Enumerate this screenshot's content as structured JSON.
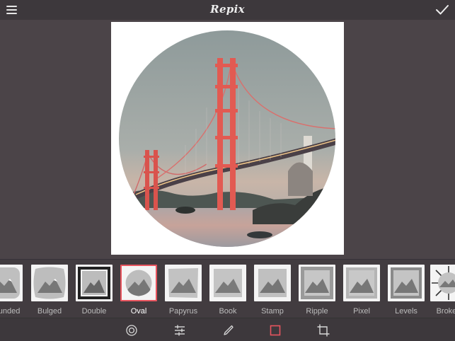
{
  "app": {
    "title": "Repix"
  },
  "header": {
    "menu_icon": "hamburger-menu-icon",
    "confirm_icon": "checkmark-icon"
  },
  "photo": {
    "subject": "golden-gate-bridge",
    "frame_shape": "oval"
  },
  "frames": {
    "selected": "Oval",
    "items": [
      {
        "label": "Rounded",
        "style": "rounded"
      },
      {
        "label": "Bulged",
        "style": "bulged"
      },
      {
        "label": "Double",
        "style": "double"
      },
      {
        "label": "Oval",
        "style": "oval"
      },
      {
        "label": "Papyrus",
        "style": "papyrus"
      },
      {
        "label": "Book",
        "style": "book"
      },
      {
        "label": "Stamp",
        "style": "stamp"
      },
      {
        "label": "Ripple",
        "style": "ripple"
      },
      {
        "label": "Pixel",
        "style": "pixel"
      },
      {
        "label": "Levels",
        "style": "levels"
      },
      {
        "label": "Broken",
        "style": "broken"
      }
    ]
  },
  "toolbar": {
    "tools": [
      {
        "name": "filters",
        "icon": "aperture-icon",
        "active": false
      },
      {
        "name": "adjust",
        "icon": "sliders-icon",
        "active": false
      },
      {
        "name": "brushes",
        "icon": "brush-icon",
        "active": false
      },
      {
        "name": "frames",
        "icon": "frame-icon",
        "active": true
      },
      {
        "name": "crop",
        "icon": "crop-icon",
        "active": false
      }
    ],
    "active_color": "#e8555f"
  },
  "colors": {
    "accent": "#e8555f",
    "background": "#4b4448",
    "bar": "#3d383c"
  }
}
